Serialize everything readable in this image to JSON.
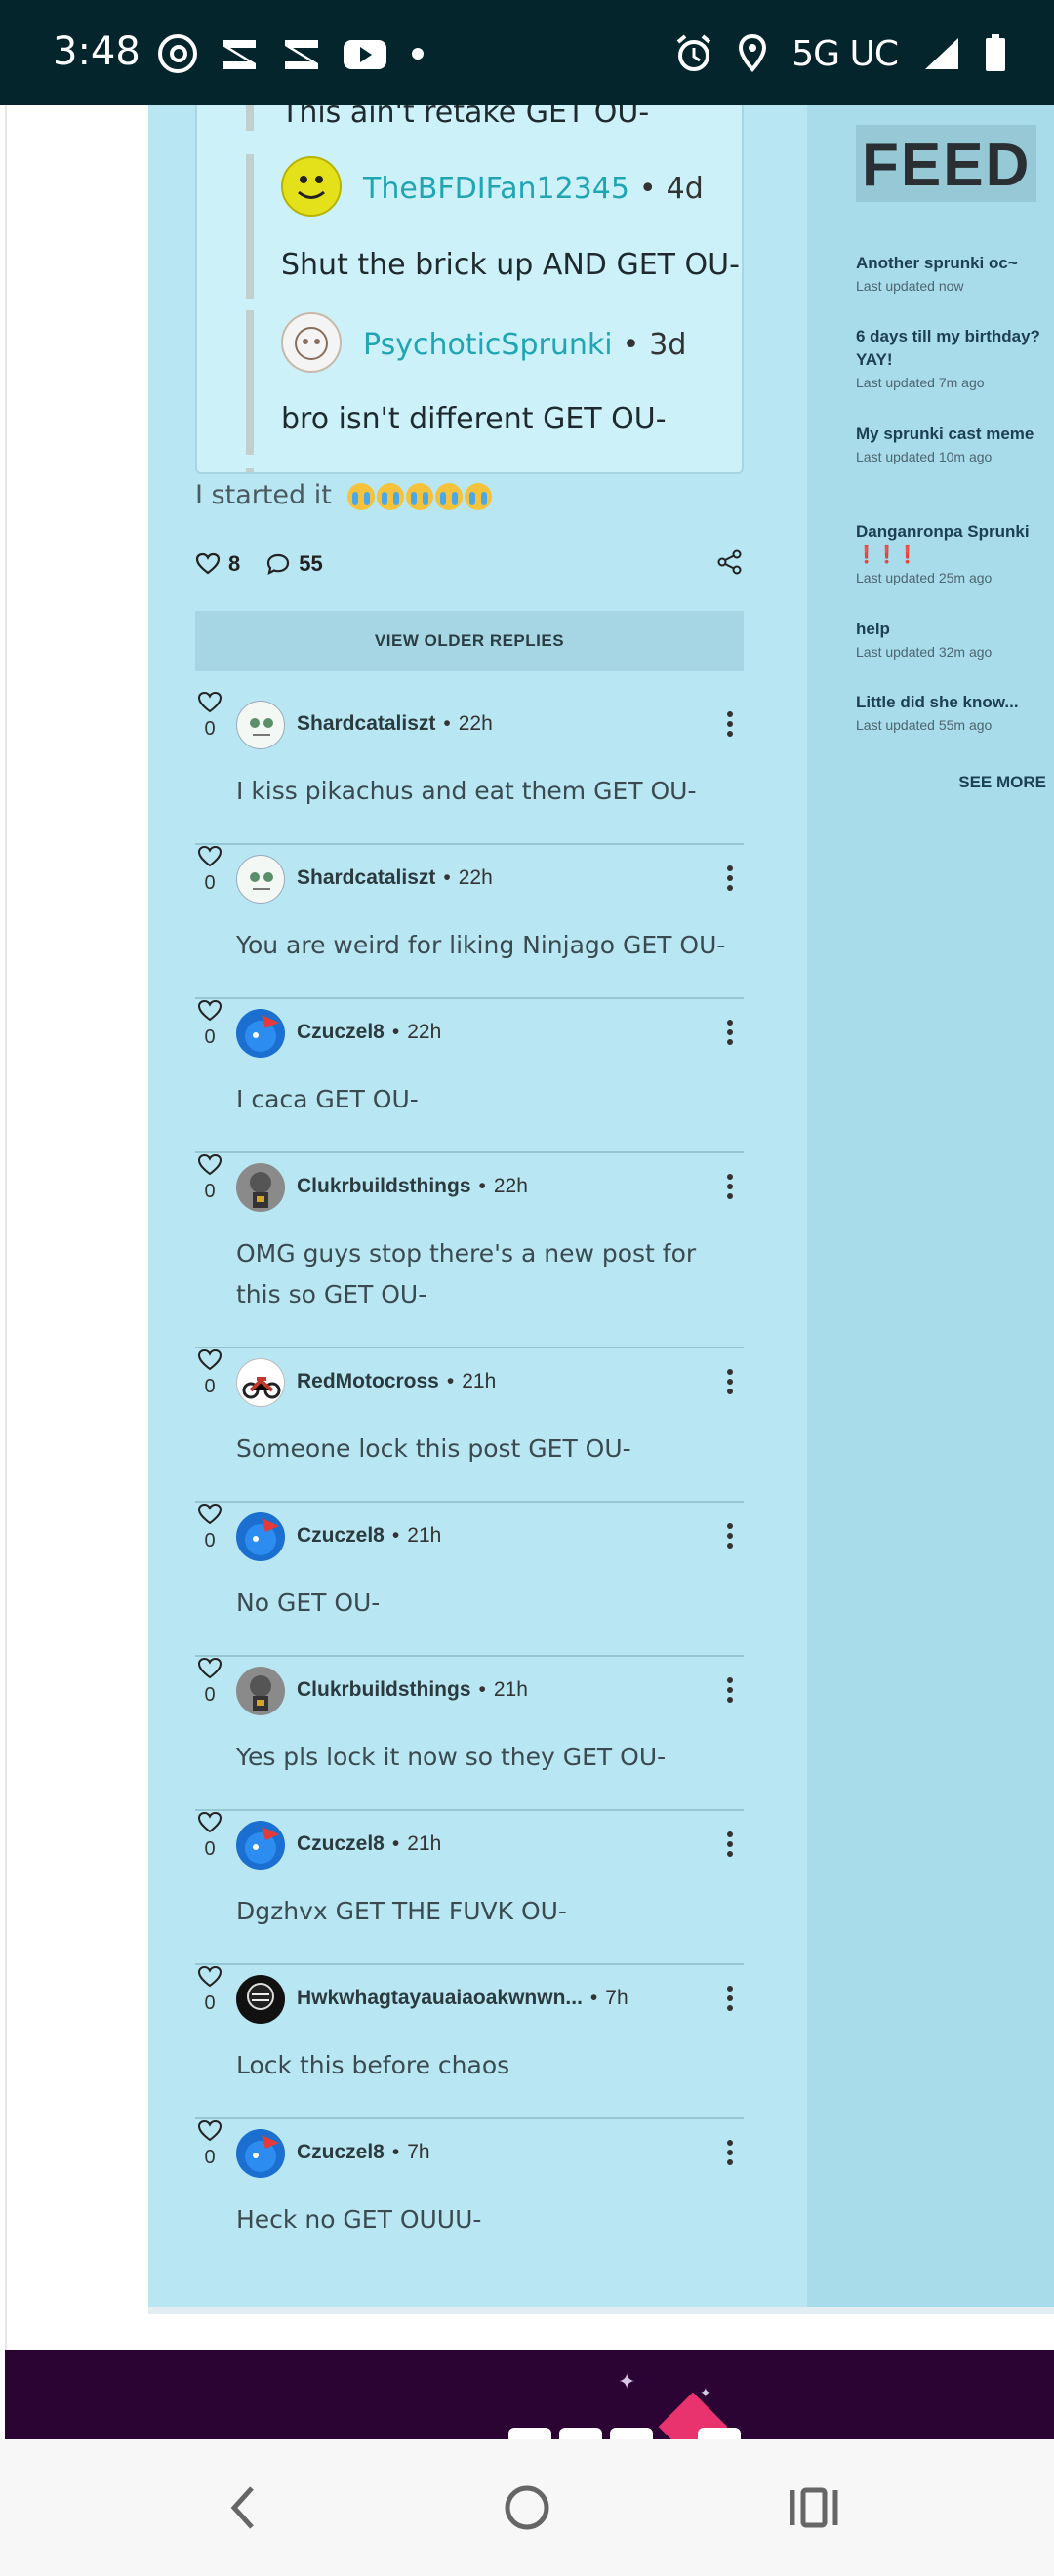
{
  "status_bar": {
    "time": "3:48",
    "left_icons": [
      "threads-icon",
      "capcut-icon",
      "capcut-icon",
      "youtube-icon",
      "dot-icon"
    ],
    "network": "5G UC",
    "right_icons": [
      "alarm-icon",
      "location-icon",
      "signal-icon",
      "battery-icon"
    ]
  },
  "quoted_thread": {
    "items": [
      {
        "type": "text",
        "text": "This ain't retake GET OU-"
      },
      {
        "type": "author",
        "name": "TheBFDIFan12345",
        "time": "4d"
      },
      {
        "type": "text",
        "text": "Shut the brick up AND GET OU-"
      },
      {
        "type": "author",
        "name": "PsychoticSprunki",
        "time": "3d"
      },
      {
        "type": "text",
        "text": "bro isn't different GET OU-"
      }
    ]
  },
  "post": {
    "body": "I started it",
    "likes": "8",
    "comments": "55"
  },
  "older_replies_label": "VIEW OLDER REPLIES",
  "replies": [
    {
      "user": "Shardcataliszt",
      "time": "22h",
      "likes": "0",
      "text": "I kiss pikachus and eat them GET OU-"
    },
    {
      "user": "Shardcataliszt",
      "time": "22h",
      "likes": "0",
      "text": "You are weird for liking Ninjago GET OU-"
    },
    {
      "user": "Czuczel8",
      "time": "22h",
      "likes": "0",
      "text": "I caca GET OU-"
    },
    {
      "user": "Clukrbuildsthings",
      "time": "22h",
      "likes": "0",
      "text": "OMG guys stop there's a new post for this so GET OU-"
    },
    {
      "user": "RedMotocross",
      "time": "21h",
      "likes": "0",
      "text": "Someone lock this post GET OU-"
    },
    {
      "user": "Czuczel8",
      "time": "21h",
      "likes": "0",
      "text": "No GET OU-"
    },
    {
      "user": "Clukrbuildsthings",
      "time": "21h",
      "likes": "0",
      "text": "Yes pls lock it now so they GET OU-"
    },
    {
      "user": "Czuczel8",
      "time": "21h",
      "likes": "0",
      "text": "Dgzhvx GET THE FUVK OU-"
    },
    {
      "user": "Hwkwhagtayauaiaoakwnwn...",
      "time": "7h",
      "likes": "0",
      "text": "Lock this before chaos"
    },
    {
      "user": "Czuczel8",
      "time": "7h",
      "likes": "0",
      "text": "Heck no GET OUUU-"
    }
  ],
  "feed": {
    "title": "FEED",
    "items": [
      {
        "name": "Another sprunki oc~",
        "updated": "Last updated now"
      },
      {
        "name": "6 days till my birthday? YAY!",
        "updated": "Last updated 7m ago"
      },
      {
        "name": "My sprunki cast meme",
        "updated": "Last updated 10m ago"
      },
      {
        "name": "Danganronpa Sprunki ❗❗❗",
        "updated": "Last updated 25m ago"
      },
      {
        "name": "help",
        "updated": "Last updated 32m ago"
      },
      {
        "name": "Little did she know...",
        "updated": "Last updated 55m ago"
      }
    ],
    "see_more": "SEE MORE"
  },
  "nav_bar": {
    "buttons": [
      "back-icon",
      "home-icon",
      "recents-icon"
    ]
  },
  "colors": {
    "main_bg": "#b8e6f2",
    "rail_bg": "#a9dcea",
    "link": "#21a5b3",
    "status_bar": "#05252d",
    "footer": "#2b0433"
  }
}
